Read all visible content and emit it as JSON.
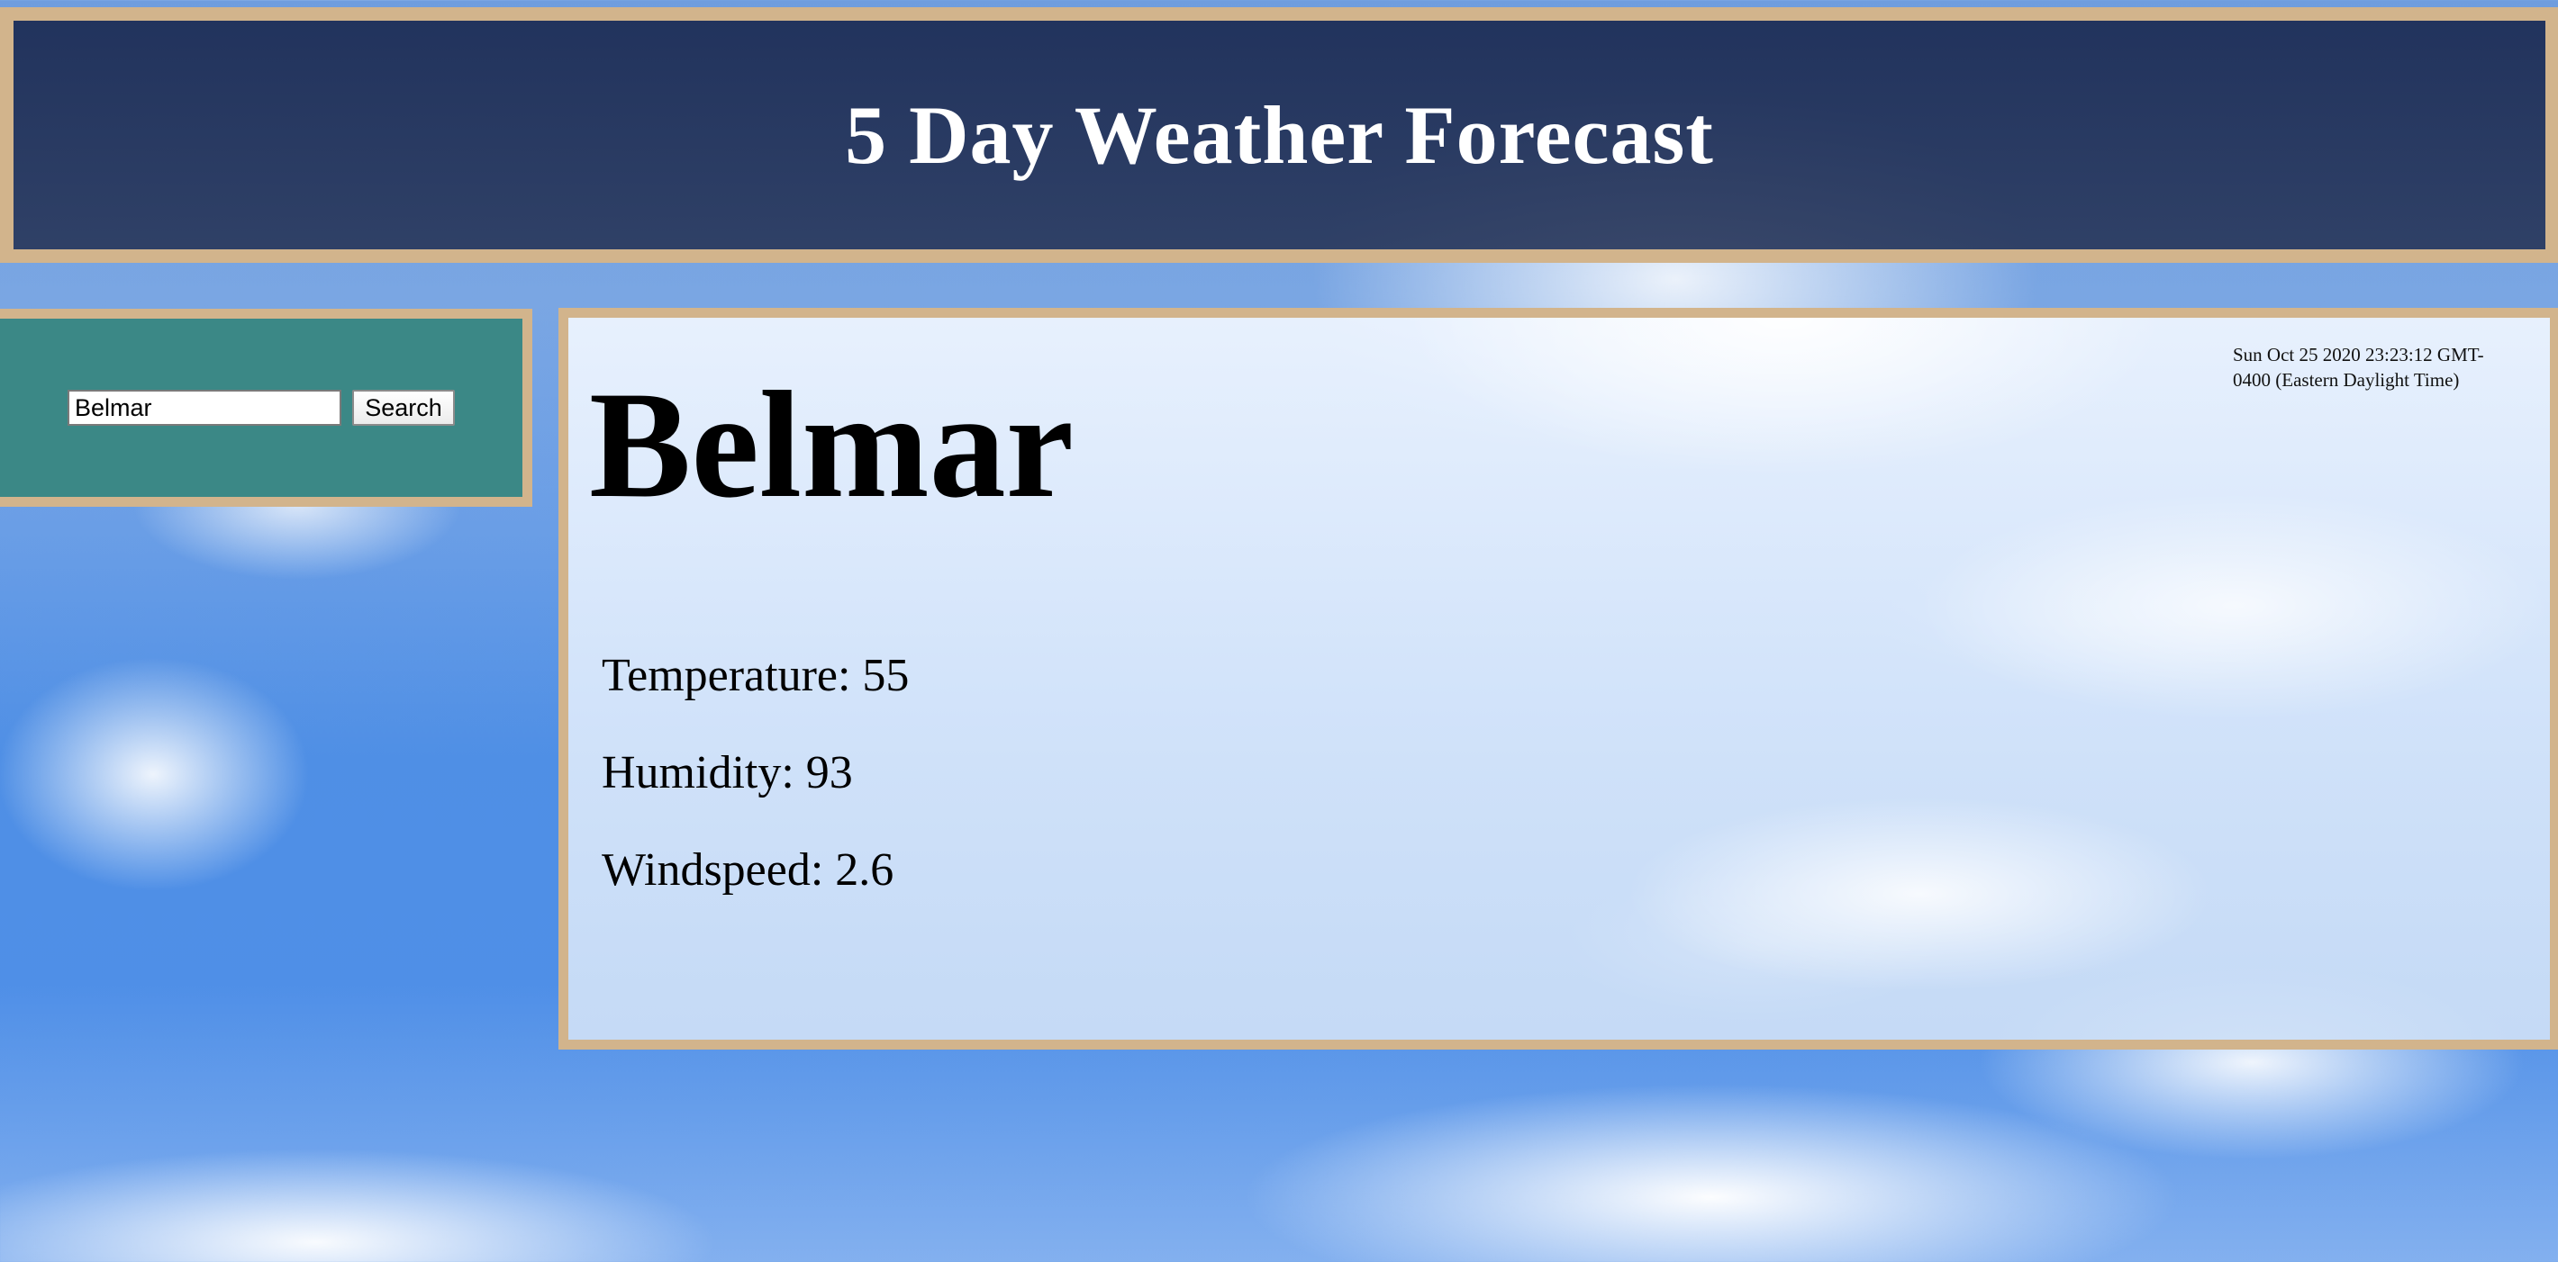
{
  "header": {
    "title": "5 Day Weather Forecast"
  },
  "search": {
    "value": "Belmar",
    "button_label": "Search"
  },
  "current": {
    "timestamp": "Sun Oct 25 2020 23:23:12 GMT-0400 (Eastern Daylight Time)",
    "city": "Belmar",
    "temperature": "Temperature: 55",
    "humidity": "Humidity: 93",
    "windspeed": "Windspeed: 2.6"
  },
  "colors": {
    "header_bg": "#27375c",
    "panel_border": "#d2b48c",
    "search_panel_bg": "#3b8886"
  }
}
